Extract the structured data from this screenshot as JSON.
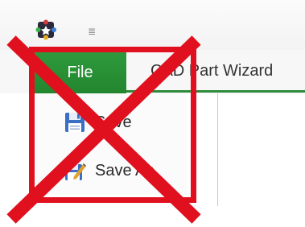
{
  "quick_access": {
    "app_icon": "app-puzzle-icon",
    "dropdown_glyph": "≣"
  },
  "ribbon": {
    "file_tab_label": "File",
    "tabs": [
      {
        "label": "CAD Part Wizard"
      }
    ]
  },
  "file_menu": {
    "items": [
      {
        "label": "Save",
        "icon": "save-icon"
      },
      {
        "label": "Save As",
        "icon": "save-as-icon"
      }
    ]
  },
  "overlay": {
    "color": "#e0101f",
    "meaning": "crossed-out"
  },
  "colors": {
    "accent": "#2e8b3a",
    "file_tab": "#2e9a3c"
  }
}
